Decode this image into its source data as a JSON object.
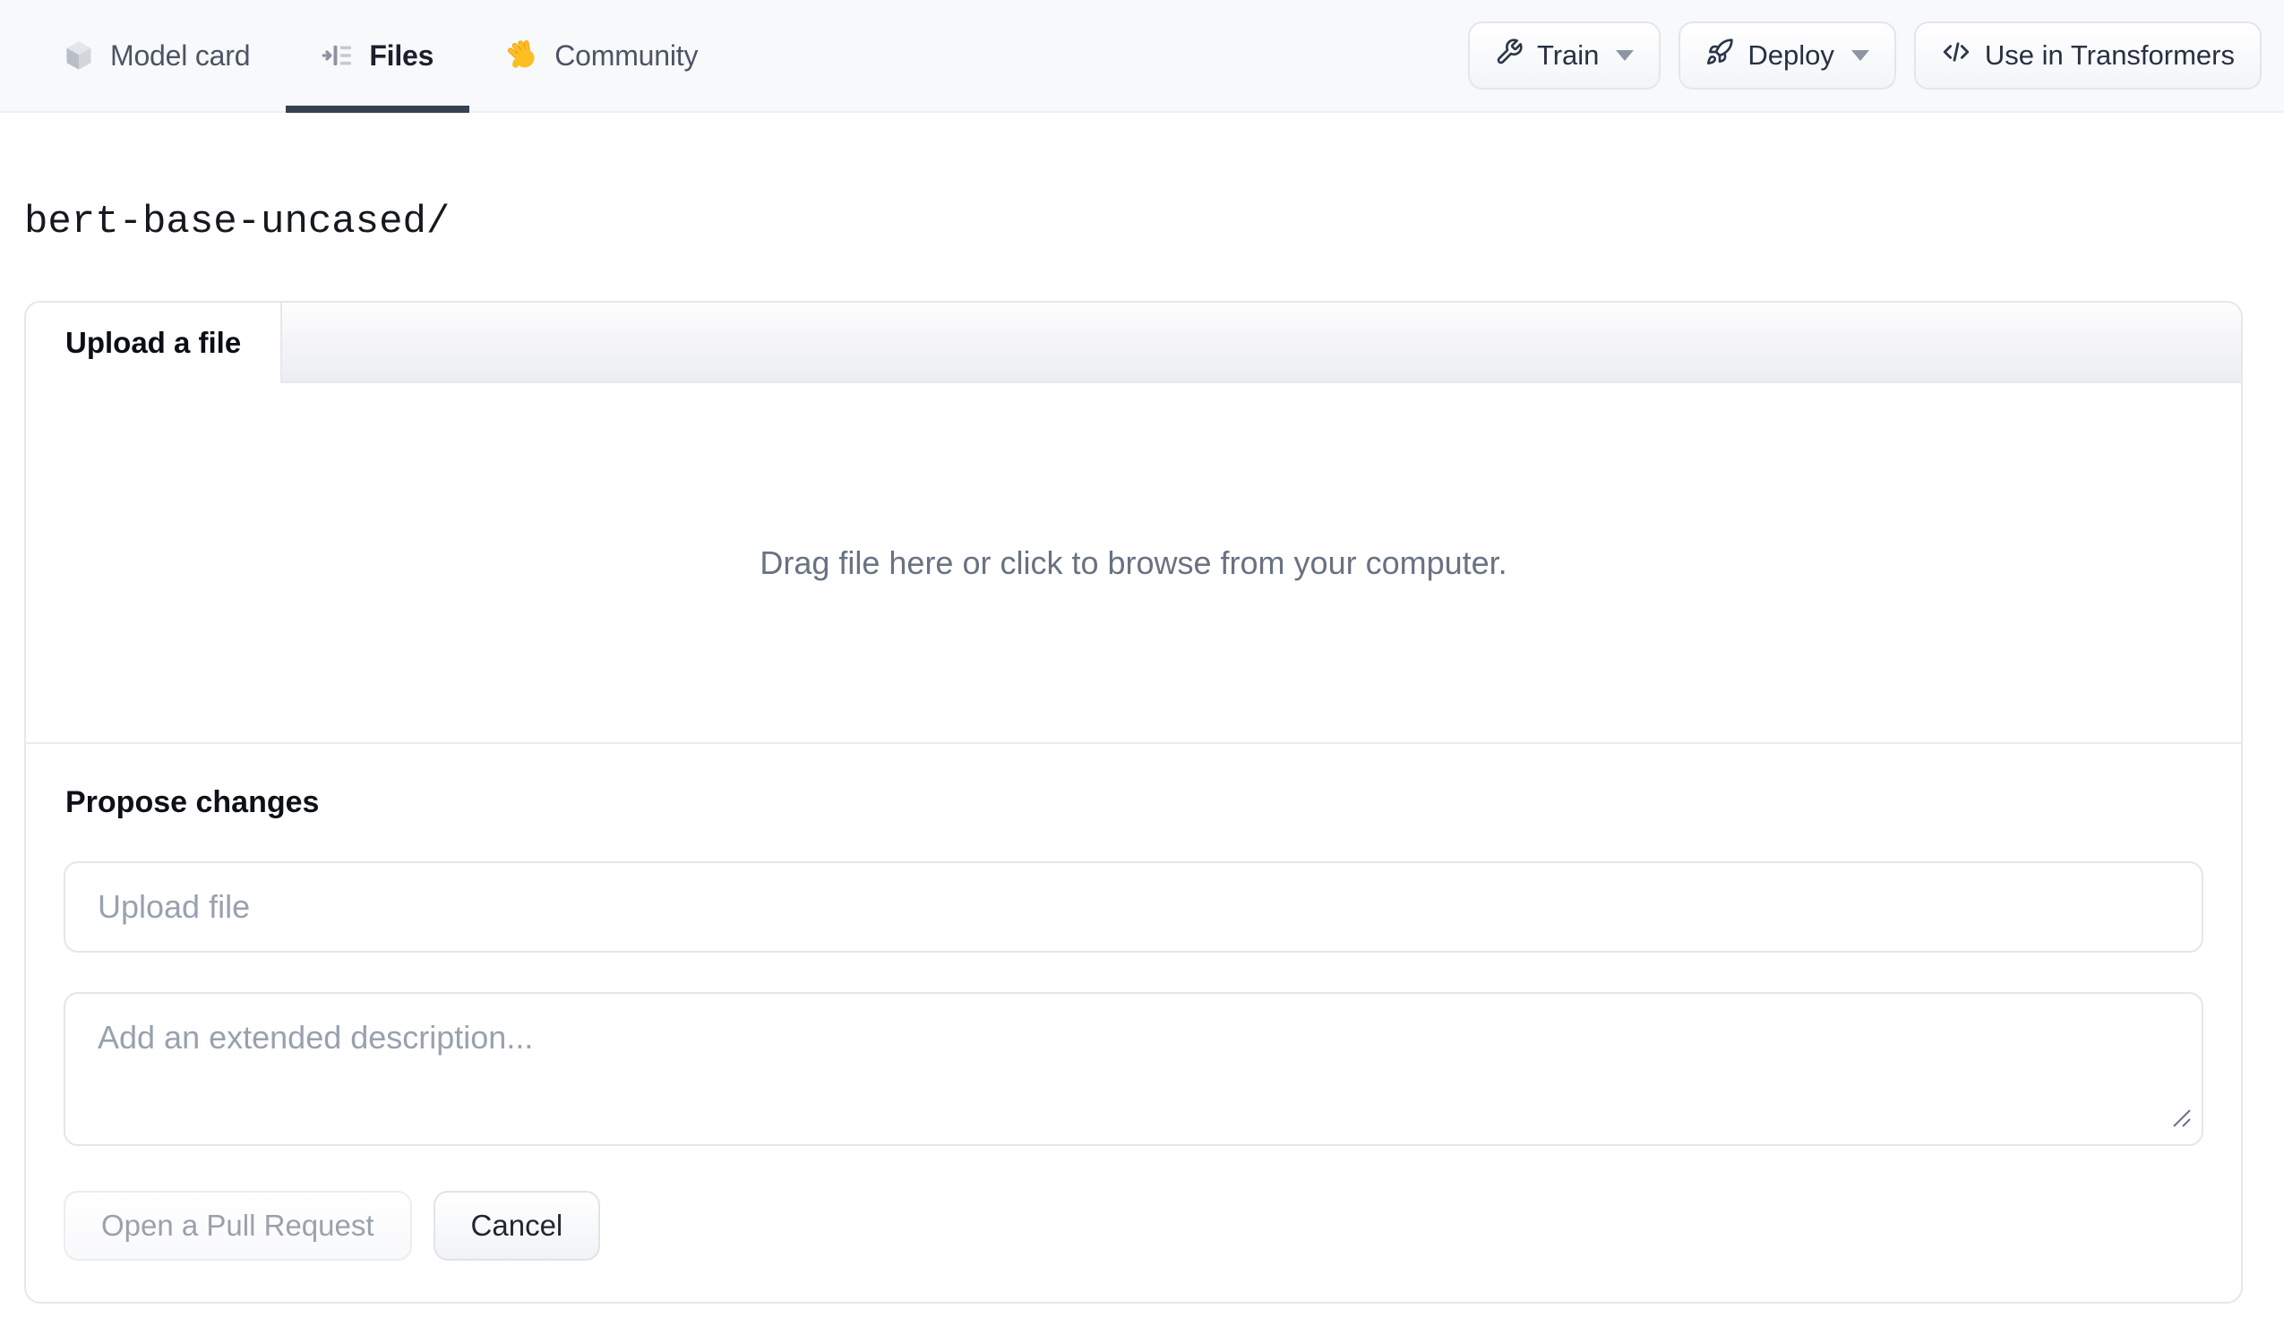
{
  "header": {
    "tabs": [
      {
        "label": "Model card",
        "icon": "cube-icon",
        "active": false
      },
      {
        "label": "Files",
        "icon": "files-list-icon",
        "active": true
      },
      {
        "label": "Community",
        "icon": "waving-hand-icon",
        "active": false
      }
    ],
    "actions": [
      {
        "label": "Train",
        "icon": "wrench-icon",
        "has_caret": true
      },
      {
        "label": "Deploy",
        "icon": "rocket-icon",
        "has_caret": true
      },
      {
        "label": "Use in Transformers",
        "icon": "code-icon",
        "has_caret": false
      }
    ]
  },
  "breadcrumb": {
    "path": "bert-base-uncased/"
  },
  "upload_card": {
    "tab_label": "Upload a file",
    "dropzone_text": "Drag file here or click to browse from your computer.",
    "propose": {
      "heading": "Propose changes",
      "filename_placeholder": "Upload file",
      "description_placeholder": "Add an extended description...",
      "open_pr_label": "Open a Pull Request",
      "cancel_label": "Cancel"
    }
  },
  "colors": {
    "header_bg": "#f8f9fb",
    "active_tab_underline": "#364152",
    "muted_text": "#687281",
    "placeholder_text": "#98a1af",
    "disabled_button_text": "#9ba1ac",
    "hand_emoji_yellow": "#fbbf24"
  }
}
